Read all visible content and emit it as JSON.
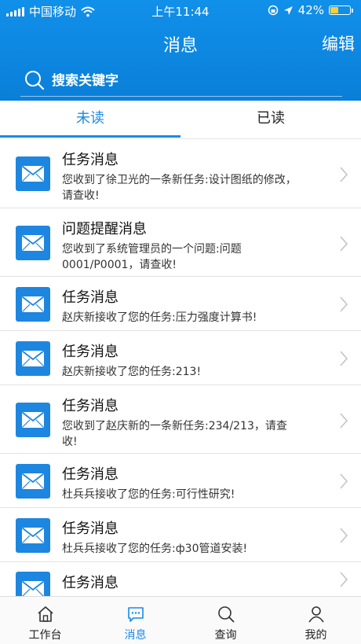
{
  "status_bar": {
    "carrier": "中国移动",
    "time": "上午11:44",
    "battery": "42%",
    "battery_level": 0.42,
    "battery_color": "#f6cf3a"
  },
  "header": {
    "title": "消息",
    "edit_label": "编辑",
    "bg_color": "#0a7fd8"
  },
  "search": {
    "placeholder": "搜索关键字",
    "icon": "search-icon"
  },
  "tabs": [
    {
      "label": "未读",
      "active": true
    },
    {
      "label": "已读",
      "active": false
    }
  ],
  "messages": [
    {
      "title": "任务消息",
      "body": "您收到了徐卫光的一条新任务:设计图纸的修改，请查收!",
      "icon": "mail-icon"
    },
    {
      "title": "问题提醒消息",
      "body": "您收到了系统管理员的一个问题:问题0001/P0001，请查收!",
      "icon": "mail-icon"
    },
    {
      "title": "任务消息",
      "body": "赵庆新接收了您的任务:压力强度计算书!",
      "icon": "mail-icon"
    },
    {
      "title": "任务消息",
      "body": "赵庆新接收了您的任务:213!",
      "icon": "mail-icon"
    },
    {
      "title": "任务消息",
      "body": "您收到了赵庆新的一条新任务:234/213，请查收!",
      "icon": "mail-icon"
    },
    {
      "title": "任务消息",
      "body": "杜兵兵接收了您的任务:可行性研究!",
      "icon": "mail-icon"
    },
    {
      "title": "任务消息",
      "body": "杜兵兵接收了您的任务:ф30管道安装!",
      "icon": "mail-icon"
    },
    {
      "title": "任务消息",
      "body": "",
      "icon": "mail-icon"
    }
  ],
  "bottom_nav": [
    {
      "label": "工作台",
      "icon": "home-icon",
      "active": false
    },
    {
      "label": "消息",
      "icon": "chat-icon",
      "active": true
    },
    {
      "label": "查询",
      "icon": "search-icon",
      "active": false
    },
    {
      "label": "我的",
      "icon": "user-icon",
      "active": false
    }
  ],
  "colors": {
    "accent": "#1a8ae6",
    "icon_bg": "#1d86e0"
  }
}
